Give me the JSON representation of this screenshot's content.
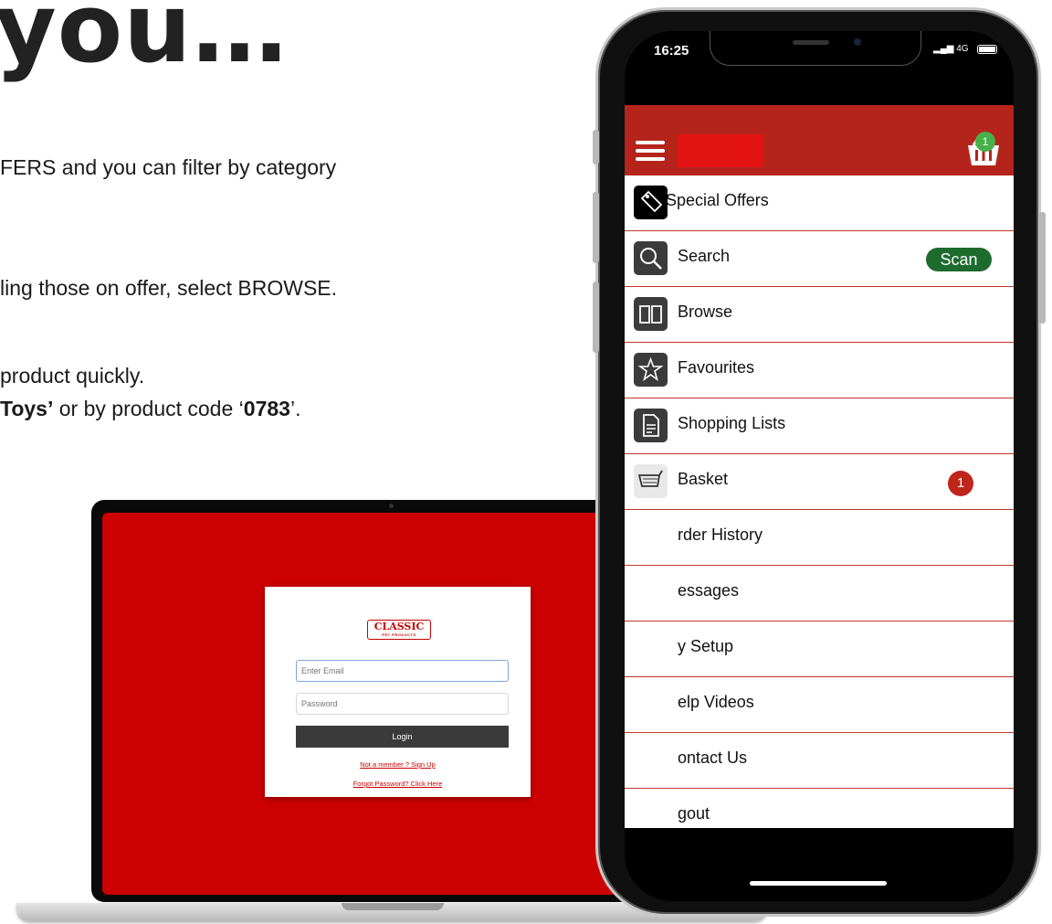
{
  "slide": {
    "title": "you…",
    "lines": [
      {
        "text": "FERS and you can filter by category"
      },
      {
        "text": "ling those on offer, select BROWSE."
      },
      {
        "text": "product quickly."
      },
      {
        "bold_prefix": "Toys’",
        "mid": " or by product code ‘",
        "code": "0783",
        "suffix": "’."
      }
    ]
  },
  "laptop": {
    "logo_text": "CLASSIC",
    "logo_subtext": "PET PRODUCTS",
    "email_placeholder": "Enter Email",
    "password_placeholder": "Password",
    "login_label": "Login",
    "signup_link": "Not a member ? Sign Up",
    "forgot_link": "Forgot Password? Click Here"
  },
  "phone": {
    "status": {
      "time": "16:25",
      "network": "4G"
    },
    "basket_count": "1",
    "menu": [
      {
        "label": "Special Offers",
        "icon": "tag-icon"
      },
      {
        "label": "Search",
        "icon": "search-icon",
        "action": "Scan"
      },
      {
        "label": "Browse",
        "icon": "book-icon"
      },
      {
        "label": "Favourites",
        "icon": "star-icon"
      },
      {
        "label": "Shopping Lists",
        "icon": "document-icon"
      },
      {
        "label": "Basket",
        "icon": "cart-icon",
        "badge": "1"
      },
      {
        "label": "rder History",
        "icon": "history-icon"
      },
      {
        "label": "essages",
        "icon": "messages-icon"
      },
      {
        "label": "y Setup",
        "icon": "setup-icon"
      },
      {
        "label": "elp Videos",
        "icon": "video-icon"
      },
      {
        "label": "ontact Us",
        "icon": "contact-icon"
      },
      {
        "label": "gout",
        "icon": "logout-icon"
      }
    ]
  },
  "colors": {
    "brand_red": "#cc0000",
    "header_red": "#b5241b",
    "scan_green": "#1e6b2e",
    "badge_red": "#c0251c"
  }
}
